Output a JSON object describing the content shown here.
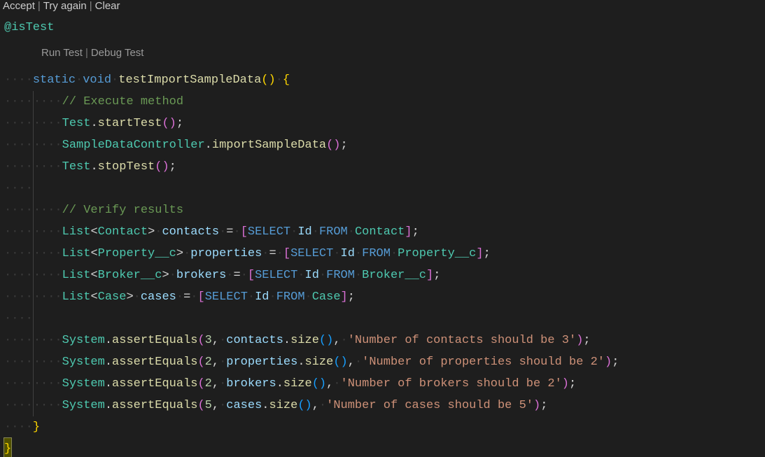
{
  "top_actions": {
    "accept": "Accept",
    "try_again": "Try again",
    "clear": "Clear"
  },
  "codelens": {
    "run": "Run Test",
    "debug": "Debug Test"
  },
  "code": {
    "istest": "@isTest",
    "sig": {
      "static": "static",
      "void": "void",
      "name": "testImportSampleData"
    },
    "cmt_exec": "// Execute method",
    "t_start": {
      "cls": "Test",
      "m": "startTest"
    },
    "sdc": {
      "cls": "SampleDataController",
      "m": "importSampleData"
    },
    "t_stop": {
      "cls": "Test",
      "m": "stopTest"
    },
    "cmt_verify": "// Verify results",
    "q1": {
      "decl": "List",
      "gen": "Contact",
      "var": "contacts",
      "sel": "SELECT",
      "id": "Id",
      "from": "FROM",
      "obj": "Contact"
    },
    "q2": {
      "decl": "List",
      "gen": "Property__c",
      "var": "properties",
      "sel": "SELECT",
      "id": "Id",
      "from": "FROM",
      "obj": "Property__c"
    },
    "q3": {
      "decl": "List",
      "gen": "Broker__c",
      "var": "brokers",
      "sel": "SELECT",
      "id": "Id",
      "from": "FROM",
      "obj": "Broker__c"
    },
    "q4": {
      "decl": "List",
      "gen": "Case",
      "var": "cases",
      "sel": "SELECT",
      "id": "Id",
      "from": "FROM",
      "obj": "Case"
    },
    "a1": {
      "sys": "System",
      "m": "assertEquals",
      "n": "3",
      "v": "contacts",
      "sz": "size",
      "msg": "'Number of contacts should be 3'"
    },
    "a2": {
      "sys": "System",
      "m": "assertEquals",
      "n": "2",
      "v": "properties",
      "sz": "size",
      "msg": "'Number of properties should be 2'"
    },
    "a3": {
      "sys": "System",
      "m": "assertEquals",
      "n": "2",
      "v": "brokers",
      "sz": "size",
      "msg": "'Number of brokers should be 2'"
    },
    "a4": {
      "sys": "System",
      "m": "assertEquals",
      "n": "5",
      "v": "cases",
      "sz": "size",
      "msg": "'Number of cases should be 5'"
    }
  }
}
